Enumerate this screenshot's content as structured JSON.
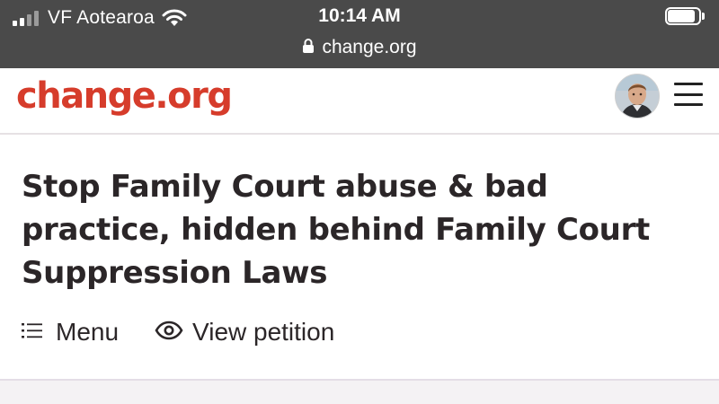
{
  "status_bar": {
    "carrier": "VF Aotearoa",
    "time": "10:14 AM",
    "url": "change.org",
    "icons": [
      "signal-icon",
      "wifi-icon",
      "battery-icon",
      "lock-icon"
    ]
  },
  "header": {
    "logo": "change.org",
    "brand_color": "#d63c2b",
    "icons": [
      "avatar",
      "hamburger-menu-icon"
    ]
  },
  "petition": {
    "title": "Stop Family Court abuse & bad practice, hidden behind Family Court Suppression Laws",
    "actions": {
      "menu_label": "Menu",
      "menu_icon": "list-icon",
      "view_label": "View petition",
      "view_icon": "eye-icon"
    }
  }
}
